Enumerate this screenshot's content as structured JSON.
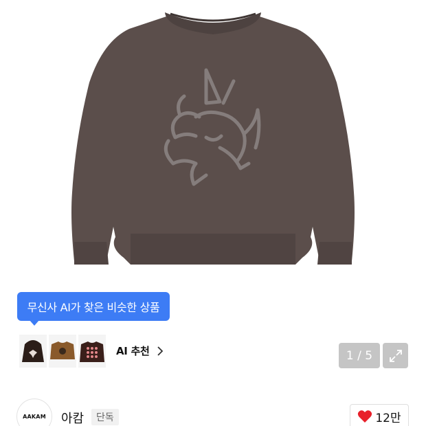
{
  "product": {
    "image_alt": "brown knit sweater with gray dragon graphic"
  },
  "ai_recommend": {
    "tooltip": "무신사 AI가 찾은 비슷한 상품",
    "label": "AI 추천",
    "thumbnails": [
      "hoodie-thumb",
      "brown-sweater-thumb",
      "dot-sweater-thumb"
    ]
  },
  "gallery": {
    "indicator": "1 / 5"
  },
  "brand": {
    "logo_text": "AAKAM",
    "name": "아캄",
    "badge": "단독"
  },
  "like": {
    "count": "12만",
    "color": "#e8202a"
  },
  "colors": {
    "accent": "#3d7cf5",
    "sweater": "#5b4e4b",
    "graphic": "#8a8382"
  }
}
